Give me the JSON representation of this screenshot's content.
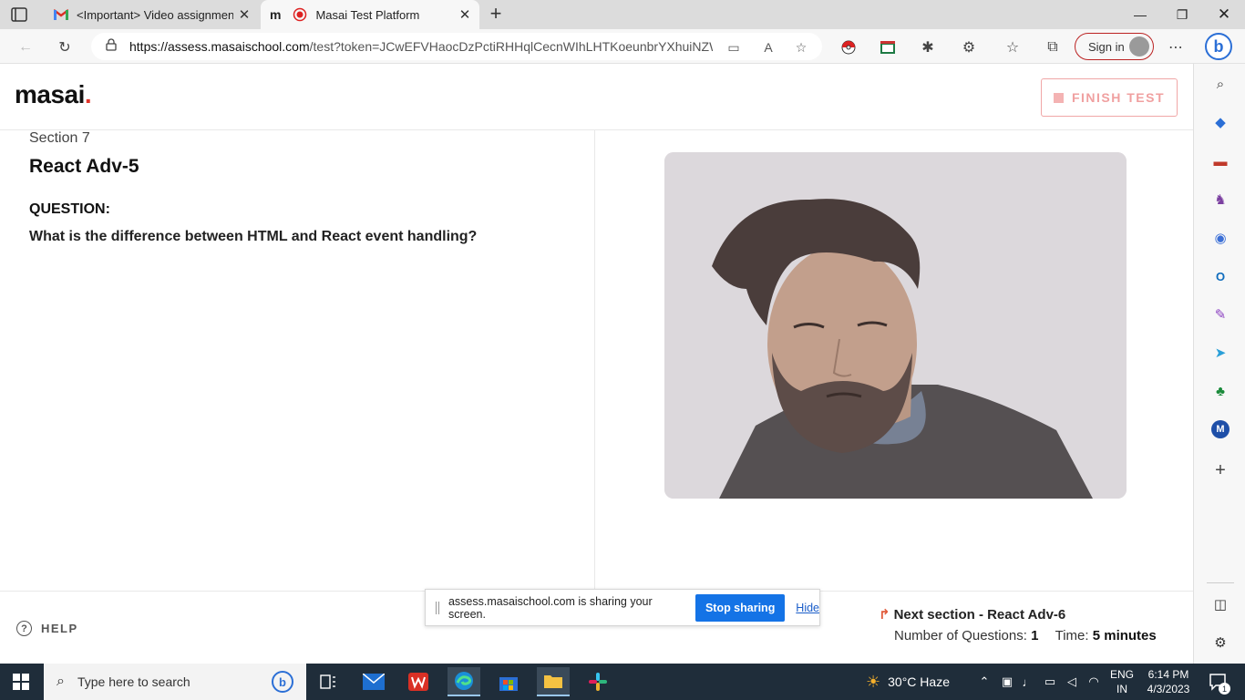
{
  "browser": {
    "tabs": [
      {
        "title": "<Important> Video assignment",
        "active": false
      },
      {
        "title": "Masai Test Platform",
        "active": true
      }
    ],
    "url_host": "https://assess.masaischool.com",
    "url_rest": "/test?token=JCwEFVHaocDzPctiRHHqlCecnWIhLHTKoeunbrYXhuiNZW...",
    "sign_in_label": "Sign in",
    "bing_label": "b"
  },
  "page": {
    "logo": "masai",
    "logo_dot": ".",
    "finish_label": "FINISH TEST",
    "section_label": "Section 7",
    "section_title": "React Adv-5",
    "question_label": "QUESTION:",
    "question_text": "What is the difference between HTML and React event handling?",
    "help_label": "HELP",
    "next_section": "Next section - React Adv-6",
    "questions_label": "Number of Questions:",
    "questions_count": "1",
    "time_label": "Time:",
    "time_value": "5 minutes"
  },
  "share_bar": {
    "message": "assess.masaischool.com is sharing your screen.",
    "stop_label": "Stop sharing",
    "hide_label": "Hide"
  },
  "sidebar_icons": [
    "search-icon",
    "tag-icon",
    "toolbox-icon",
    "games-icon",
    "office-icon",
    "outlook-icon",
    "designer-icon",
    "telegram-icon",
    "tree-icon",
    "m-app-icon",
    "add-icon",
    "split-screen-icon",
    "settings-icon"
  ],
  "sidebar": {
    "m_letter": "M"
  },
  "taskbar": {
    "search_placeholder": "Type here to search",
    "weather": "30°C  Haze",
    "lang_top": "ENG",
    "lang_bottom": "IN",
    "time": "6:14 PM",
    "date": "4/3/2023",
    "notif_count": "1"
  },
  "colors": {
    "accent_red": "#e2352b",
    "finish_border": "#f0a7a7",
    "stop_button": "#1473e6",
    "taskbar": "#1f2d3a"
  }
}
